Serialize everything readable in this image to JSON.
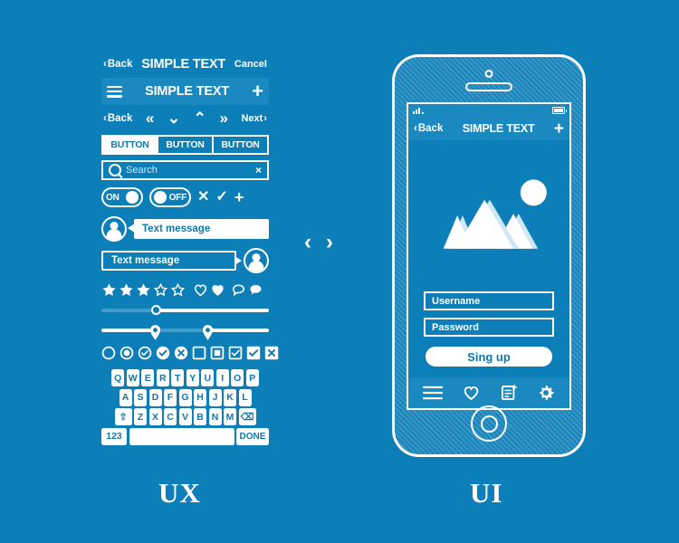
{
  "theme": {
    "background": "#0d7fb8",
    "bar_blue": "#1a89c0",
    "white": "#ffffff",
    "text_on_white": "#1178ad",
    "placeholder": "#cfe6f3"
  },
  "captions": {
    "ux": "UX",
    "ui": "UI"
  },
  "center_arrows": {
    "left": "‹",
    "right": "›"
  },
  "ux": {
    "navbar_plain": {
      "back": "Back",
      "title": "SIMPLE TEXT",
      "cancel": "Cancel",
      "back_chevron": "‹"
    },
    "navbar_filled": {
      "menu_icon": "hamburger-icon",
      "title": "SIMPLE TEXT",
      "add_icon": "plus-icon",
      "add_label": "+"
    },
    "pager": {
      "back": "Back",
      "back_chevron": "‹",
      "first": "«",
      "down": "⌄",
      "up": "⌃",
      "last": "»",
      "next": "Next",
      "next_chevron": "›"
    },
    "segmented": [
      {
        "label": "BUTTON",
        "state": "selected"
      },
      {
        "label": "BUTTON",
        "state": "normal"
      },
      {
        "label": "BUTTON",
        "state": "normal"
      }
    ],
    "search": {
      "icon": "search-icon",
      "placeholder": "Search",
      "clear": "×"
    },
    "toggles": [
      {
        "label": "ON",
        "state": "on"
      },
      {
        "label": "OFF",
        "state": "off"
      }
    ],
    "action_icons": [
      {
        "name": "close-icon",
        "glyph": "✕"
      },
      {
        "name": "check-icon",
        "glyph": "✓"
      },
      {
        "name": "plus-icon",
        "glyph": "+"
      }
    ],
    "chat": {
      "incoming": "Text message",
      "outgoing": "Text message"
    },
    "rating": {
      "filled_stars": 3,
      "empty_stars": 2,
      "icons": [
        {
          "name": "heart-outline-icon"
        },
        {
          "name": "heart-filled-icon"
        },
        {
          "name": "comment-outline-icon"
        },
        {
          "name": "comment-filled-icon"
        }
      ]
    },
    "sliders": [
      {
        "name": "single-slider",
        "value_percent": 33
      },
      {
        "name": "range-slider",
        "low_percent": 32,
        "high_percent": 63
      }
    ],
    "selection_controls": [
      {
        "name": "radio-empty",
        "shape": "circle",
        "state": "empty"
      },
      {
        "name": "radio-selected",
        "shape": "circle",
        "state": "dot"
      },
      {
        "name": "radio-check-outline",
        "shape": "circle",
        "state": "check-outline"
      },
      {
        "name": "radio-check-filled",
        "shape": "circle",
        "state": "check-filled"
      },
      {
        "name": "radio-x-filled",
        "shape": "circle",
        "state": "x-filled"
      },
      {
        "name": "checkbox-empty",
        "shape": "square",
        "state": "empty"
      },
      {
        "name": "checkbox-square-filled",
        "shape": "square",
        "state": "dot"
      },
      {
        "name": "checkbox-check-outline",
        "shape": "square",
        "state": "check-outline"
      },
      {
        "name": "checkbox-check-filled",
        "shape": "square",
        "state": "check-filled"
      },
      {
        "name": "checkbox-x-filled",
        "shape": "square",
        "state": "x-filled"
      }
    ],
    "keyboard": {
      "row1": [
        "Q",
        "W",
        "E",
        "R",
        "T",
        "Y",
        "U",
        "I",
        "O",
        "P"
      ],
      "row2": [
        "A",
        "S",
        "D",
        "F",
        "G",
        "H",
        "J",
        "K",
        "L"
      ],
      "row3": [
        "Z",
        "X",
        "C",
        "V",
        "B",
        "N",
        "M"
      ],
      "shift_label": "⇧",
      "backspace_label": "⌫",
      "numbers_label": "123",
      "space_label": "",
      "done_label": "DONE"
    }
  },
  "phone": {
    "status_bar": {
      "signal_icon": "signal-bars-icon",
      "battery_icon": "battery-icon"
    },
    "navbar": {
      "back": "Back",
      "back_chevron": "‹",
      "title": "SIMPLE TEXT",
      "add_label": "+"
    },
    "hero": {
      "name": "mountains-image-placeholder"
    },
    "form": {
      "username_placeholder": "Username",
      "password_placeholder": "Password",
      "submit_label": "Sing up"
    },
    "tabbar": [
      {
        "name": "menu-icon"
      },
      {
        "name": "heart-icon"
      },
      {
        "name": "new-document-icon"
      },
      {
        "name": "settings-gear-icon"
      }
    ],
    "home_button": {
      "name": "home-button"
    }
  }
}
